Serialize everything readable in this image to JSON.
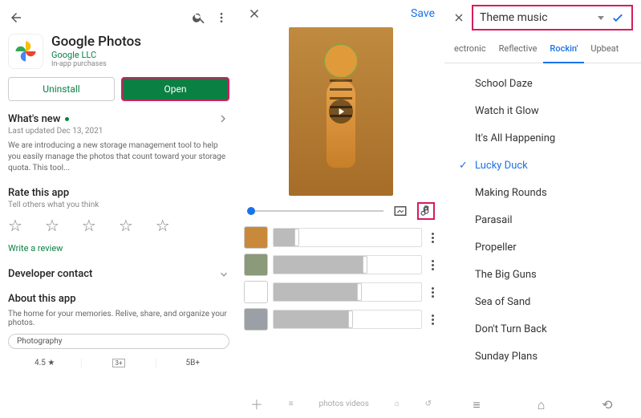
{
  "store": {
    "app_title": "Google Photos",
    "publisher": "Google LLC",
    "subline": "In-app purchases",
    "uninstall_label": "Uninstall",
    "open_label": "Open",
    "whats_new_title": "What's new",
    "whats_new_updated": "Last updated Dec 13, 2021",
    "whats_new_body": "We are introducing a new storage management tool to help you easily manage the photos that count toward your storage quota. This tool...",
    "rate_title": "Rate this app",
    "rate_sub": "Tell others what you think",
    "review_link": "Write a review",
    "dev_contact": "Developer contact",
    "about_title": "About this app",
    "about_desc": "The home for your memories. Relive, share, and organize your photos.",
    "chip": "Photography",
    "stats": {
      "rating": "4.5",
      "rating_suffix": "★",
      "content": "3+",
      "downloads": "5B+"
    }
  },
  "editor": {
    "save_label": "Save",
    "clips": [
      {
        "fill": 16,
        "handle": 16
      },
      {
        "fill": 62,
        "handle": 62
      },
      {
        "fill": 58,
        "handle": 58
      },
      {
        "fill": 52,
        "handle": 52
      }
    ],
    "bottom_hint": "photos      videos"
  },
  "theme": {
    "dropdown_label": "Theme music",
    "tabs": [
      "ectronic",
      "Reflective",
      "Rockin'",
      "Upbeat"
    ],
    "active_tab": 2,
    "tracks": [
      "School Daze",
      "Watch it Glow",
      "It's All Happening",
      "Lucky Duck",
      "Making Rounds",
      "Parasail",
      "Propeller",
      "The Big Guns",
      "Sea of Sand",
      "Don't Turn Back",
      "Sunday Plans"
    ],
    "selected_track": 3
  }
}
